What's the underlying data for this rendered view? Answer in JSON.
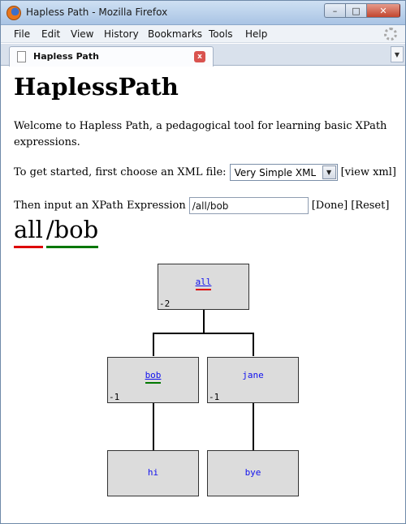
{
  "window": {
    "title": "Hapless Path - Mozilla Firefox",
    "minimize_glyph": "–",
    "maximize_glyph": "□",
    "close_glyph": "✕"
  },
  "menubar": {
    "items": [
      "File",
      "Edit",
      "View",
      "History",
      "Bookmarks",
      "Tools",
      "Help"
    ]
  },
  "tab": {
    "label": "Hapless Path",
    "close_glyph": "x",
    "list_glyph": "▼"
  },
  "page": {
    "heading": "HaplessPath",
    "welcome": "Welcome to Hapless Path, a pedagogical tool for learning basic XPath expressions.",
    "choose_prompt": "To get started, first choose an XML file:",
    "file_select": {
      "selected": "Very Simple XML",
      "arrow_glyph": "▼"
    },
    "view_xml_link": "[view xml]",
    "xpath_prompt": "Then input an XPath Expression",
    "xpath_value": "/all/bob",
    "done_link": "[Done]",
    "reset_link": "[Reset]",
    "path_segments": [
      {
        "text": "all",
        "color": "#dd0000"
      },
      {
        "text": "/bob",
        "color": "#007700"
      }
    ]
  },
  "tree": {
    "root": {
      "label": "all",
      "count": "-2",
      "highlight": "#dd0000"
    },
    "children": [
      {
        "label": "bob",
        "count": "-1",
        "highlight": "#007700"
      },
      {
        "label": "jane",
        "count": "-1"
      }
    ],
    "leaves": [
      {
        "label": "hi"
      },
      {
        "label": "bye"
      }
    ]
  }
}
